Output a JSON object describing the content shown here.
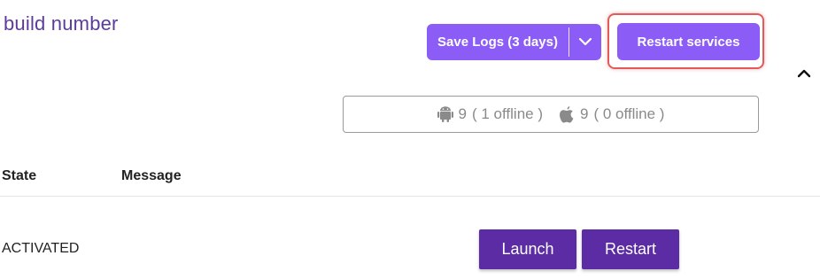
{
  "page": {
    "title": "build number"
  },
  "toolbar": {
    "save_logs_label": "Save Logs (3 days)",
    "save_logs_menu_icon": "chevron-down-icon",
    "restart_services_label": "Restart services",
    "collapse_icon": "chevron-up-icon"
  },
  "device_status": {
    "android": {
      "icon": "android-icon",
      "count": "9",
      "offline": "( 1 offline )"
    },
    "ios": {
      "icon": "apple-icon",
      "count": "9",
      "offline": "( 0 offline )"
    }
  },
  "table": {
    "columns": [
      "State",
      "Message"
    ],
    "rows": [
      {
        "state": "ACTIVATED",
        "message": "",
        "actions": [
          "Launch",
          "Restart"
        ]
      }
    ]
  },
  "colors": {
    "title": "#5b3c9a",
    "primary_button": "#8b5cf6",
    "row_button": "#5b2ca3",
    "highlight": "#e35a5a",
    "muted_text": "#8a8a8a"
  }
}
